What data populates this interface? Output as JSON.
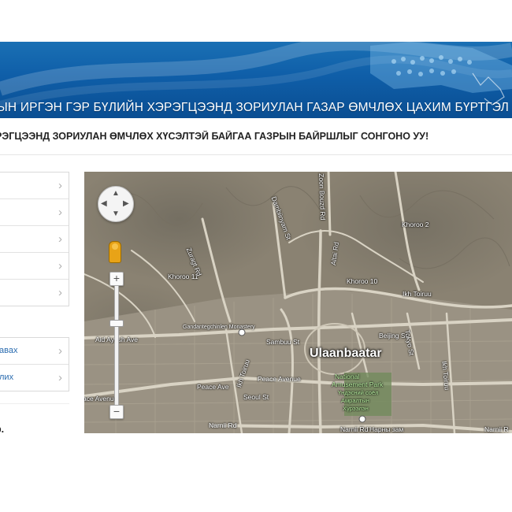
{
  "banner": {
    "title": "ЫН ИРГЭН ГЭР БҮЛИЙН ХЭРЭГЦЭЭНД ЗОРИУЛАН ГАЗАР ӨМЧЛӨХ ЦАХИМ БҮРТГЭЛИЙ"
  },
  "question": "РЭГЦЭЭНД ЗОРИУЛАН ӨМЧЛӨХ ХҮСЭЛТЭЙ БАЙГАА ГАЗРЫН БАЙРШЛЫГ СОНГОНО УУ!",
  "sidebar": {
    "group1": [
      {
        "label": ""
      },
      {
        "label": ""
      },
      {
        "label": ""
      },
      {
        "label": ""
      },
      {
        "label": ""
      }
    ],
    "group2": [
      {
        "label": "авах"
      },
      {
        "label": "лих"
      }
    ],
    "chevron": "›",
    "bottom_text": "р."
  },
  "map": {
    "labels": {
      "city": "Ulaanbaatar",
      "khoroo_11": "Khoroo 11",
      "khoroo_10": "Khoroo 10",
      "khoroo_2": "Khoroo 2",
      "ikh_toiruu": "Ikh Toiruu",
      "beijing_st": "Beijing St",
      "sambuu_st": "Sambuu St",
      "peace_avenue": "Peace Avenue",
      "peace_ave": "Peace Ave",
      "ace_avenue": "ace Avenue",
      "seoul_st": "Seoul St",
      "narnii_rd_left": "Narnii Rd",
      "narnii_rd_mid": "Narnii Rd",
      "narnii_zam": "Нарны зам",
      "narnii_rd_right": "Narnii R",
      "aid_ayush_ave": "Aid Ayush Ave",
      "monastery": "Gandantegchinlen Monastery",
      "amusement_1": "National",
      "amusement_2": "Amusement Park",
      "amusement_3": "Үндэсний соёл",
      "amusement_4": "Амралтын",
      "amusement_5": "Хүрээлэн",
      "zuragt_rd": "Zuragt Rd",
      "dambiinyam_st": "Dambiinyam St",
      "zoon_bouzd_rd": "Zoon Bouzd Rd",
      "altai_rd": "Altai Rd",
      "tokyo_st": "Tokyo St",
      "ikh_toiruu_2": "Ikh Toiruu",
      "ikh_toiruu_3": "Ikh Toiruu"
    },
    "pan_arrows": {
      "up": "▲",
      "down": "▼",
      "left": "◀",
      "right": "▶"
    },
    "zoom": {
      "plus": "+",
      "minus": "−"
    }
  },
  "colors": {
    "banner_blue": "#0f5ea8",
    "map_base": "#8a8272",
    "road": "#d9d3c4",
    "link_blue": "#2b6cb0"
  }
}
